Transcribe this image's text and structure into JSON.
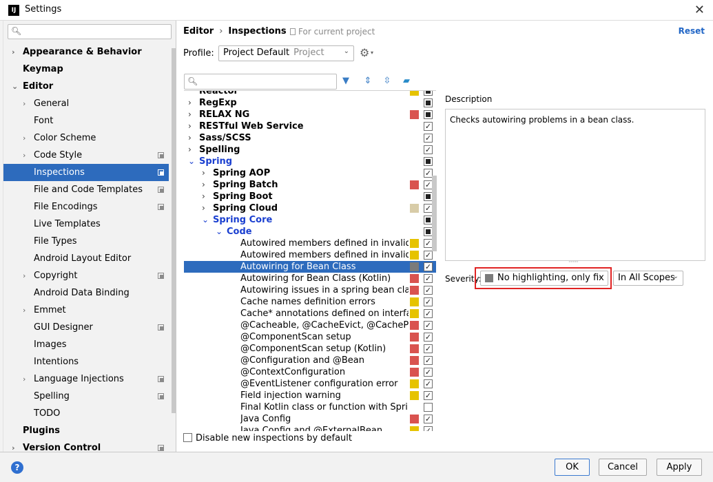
{
  "window": {
    "title": "Settings",
    "icon_text": "IJ"
  },
  "sidebar": {
    "items": [
      {
        "label": "Appearance & Behavior",
        "bold": true,
        "arrow": "›",
        "level": 0
      },
      {
        "label": "Keymap",
        "bold": true,
        "arrow": "",
        "level": 0
      },
      {
        "label": "Editor",
        "bold": true,
        "arrow": "⌄",
        "level": 0
      },
      {
        "label": "General",
        "arrow": "›",
        "level": 1
      },
      {
        "label": "Font",
        "arrow": "",
        "level": 1
      },
      {
        "label": "Color Scheme",
        "arrow": "›",
        "level": 1
      },
      {
        "label": "Code Style",
        "arrow": "›",
        "level": 1,
        "copy": true
      },
      {
        "label": "Inspections",
        "arrow": "",
        "level": 1,
        "copy": true,
        "selected": true
      },
      {
        "label": "File and Code Templates",
        "arrow": "",
        "level": 1,
        "copy": true
      },
      {
        "label": "File Encodings",
        "arrow": "",
        "level": 1,
        "copy": true
      },
      {
        "label": "Live Templates",
        "arrow": "",
        "level": 1
      },
      {
        "label": "File Types",
        "arrow": "",
        "level": 1
      },
      {
        "label": "Android Layout Editor",
        "arrow": "",
        "level": 1
      },
      {
        "label": "Copyright",
        "arrow": "›",
        "level": 1,
        "copy": true
      },
      {
        "label": "Android Data Binding",
        "arrow": "",
        "level": 1
      },
      {
        "label": "Emmet",
        "arrow": "›",
        "level": 1
      },
      {
        "label": "GUI Designer",
        "arrow": "",
        "level": 1,
        "copy": true
      },
      {
        "label": "Images",
        "arrow": "",
        "level": 1
      },
      {
        "label": "Intentions",
        "arrow": "",
        "level": 1
      },
      {
        "label": "Language Injections",
        "arrow": "›",
        "level": 1,
        "copy": true
      },
      {
        "label": "Spelling",
        "arrow": "",
        "level": 1,
        "copy": true
      },
      {
        "label": "TODO",
        "arrow": "",
        "level": 1
      },
      {
        "label": "Plugins",
        "bold": true,
        "arrow": "",
        "level": 0
      },
      {
        "label": "Version Control",
        "bold": true,
        "arrow": "›",
        "level": 0,
        "copy": true
      }
    ]
  },
  "header": {
    "breadcrumb": [
      "Editor",
      "Inspections"
    ],
    "breadcrumb_sep": "›",
    "for_project": "For current project",
    "reset_label": "Reset"
  },
  "profile": {
    "label": "Profile:",
    "value": "Project Default",
    "secondary": "Project"
  },
  "colors": {
    "accent": "#2d6bbd",
    "severity_error": "#d9534f",
    "severity_warning": "#e6c300",
    "severity_weak": "#d8cca8",
    "severity_none": "#7b7b7b",
    "highlight_border": "#e02222"
  },
  "tree": {
    "rows": [
      {
        "label": "Reactor",
        "bold": true,
        "arrow": "",
        "level": 0,
        "sev": "warning",
        "check": "partial",
        "cut": true
      },
      {
        "label": "RegExp",
        "bold": true,
        "arrow": "›",
        "level": 0,
        "sev": "",
        "check": "partial"
      },
      {
        "label": "RELAX NG",
        "bold": true,
        "arrow": "›",
        "level": 0,
        "sev": "error",
        "check": "partial"
      },
      {
        "label": "RESTful Web Service",
        "bold": true,
        "arrow": "›",
        "level": 0,
        "sev": "",
        "check": "checked"
      },
      {
        "label": "Sass/SCSS",
        "bold": true,
        "arrow": "›",
        "level": 0,
        "sev": "",
        "check": "checked"
      },
      {
        "label": "Spelling",
        "bold": true,
        "arrow": "›",
        "level": 0,
        "sev": "",
        "check": "checked"
      },
      {
        "label": "Spring",
        "bold": true,
        "blue": true,
        "arrow": "⌄",
        "level": 0,
        "sev": "",
        "check": "partial"
      },
      {
        "label": "Spring AOP",
        "bold": true,
        "arrow": "›",
        "level": 1,
        "sev": "",
        "check": "checked"
      },
      {
        "label": "Spring Batch",
        "bold": true,
        "arrow": "›",
        "level": 1,
        "sev": "error",
        "check": "checked"
      },
      {
        "label": "Spring Boot",
        "bold": true,
        "arrow": "›",
        "level": 1,
        "sev": "",
        "check": "partial"
      },
      {
        "label": "Spring Cloud",
        "bold": true,
        "arrow": "›",
        "level": 1,
        "sev": "weak",
        "check": "checked"
      },
      {
        "label": "Spring Core",
        "bold": true,
        "blue": true,
        "arrow": "⌄",
        "level": 1,
        "sev": "",
        "check": "partial"
      },
      {
        "label": "Code",
        "bold": true,
        "blue": true,
        "arrow": "⌄",
        "level": 2,
        "sev": "",
        "check": "partial"
      },
      {
        "label": "Autowired members defined in invalid Spri",
        "level": 3,
        "sev": "warning",
        "check": "checked"
      },
      {
        "label": "Autowired members defined in invalid Spri",
        "level": 3,
        "sev": "warning",
        "check": "checked"
      },
      {
        "label": "Autowiring for Bean Class",
        "level": 3,
        "sev": "none",
        "check": "checked",
        "selected": true
      },
      {
        "label": "Autowiring for Bean Class (Kotlin)",
        "level": 3,
        "sev": "error",
        "check": "checked"
      },
      {
        "label": "Autowiring issues in a spring bean class c",
        "level": 3,
        "sev": "error",
        "check": "checked"
      },
      {
        "label": "Cache names definition errors",
        "level": 3,
        "sev": "warning",
        "check": "checked"
      },
      {
        "label": "Cache* annotations defined on interfaces/",
        "level": 3,
        "sev": "warning",
        "check": "checked"
      },
      {
        "label": "@Cacheable, @CacheEvict, @CachePut, @",
        "level": 3,
        "sev": "error",
        "check": "checked"
      },
      {
        "label": "@ComponentScan setup",
        "level": 3,
        "sev": "error",
        "check": "checked"
      },
      {
        "label": "@ComponentScan setup (Kotlin)",
        "level": 3,
        "sev": "error",
        "check": "checked"
      },
      {
        "label": "@Configuration and @Bean",
        "level": 3,
        "sev": "error",
        "check": "checked"
      },
      {
        "label": "@ContextConfiguration",
        "level": 3,
        "sev": "error",
        "check": "checked"
      },
      {
        "label": "@EventListener configuration error",
        "level": 3,
        "sev": "warning",
        "check": "checked"
      },
      {
        "label": "Field injection warning",
        "level": 3,
        "sev": "warning",
        "check": "checked"
      },
      {
        "label": "Final Kotlin class or function with Spring a",
        "level": 3,
        "sev": "",
        "check": "unchecked"
      },
      {
        "label": "Java Config",
        "level": 3,
        "sev": "error",
        "check": "checked"
      },
      {
        "label": "Java Config and @ExternalBean",
        "level": 3,
        "sev": "warning",
        "check": "checked",
        "cut": true
      }
    ]
  },
  "description": {
    "label": "Description",
    "text": "Checks autowiring problems in a bean class."
  },
  "severity": {
    "label": "Severity:",
    "value": "No highlighting, only fix",
    "scope": "In All Scopes"
  },
  "options": {
    "disable_new": "Disable new inspections by default"
  },
  "buttons": {
    "help": "?",
    "ok": "OK",
    "cancel": "Cancel",
    "apply": "Apply"
  }
}
